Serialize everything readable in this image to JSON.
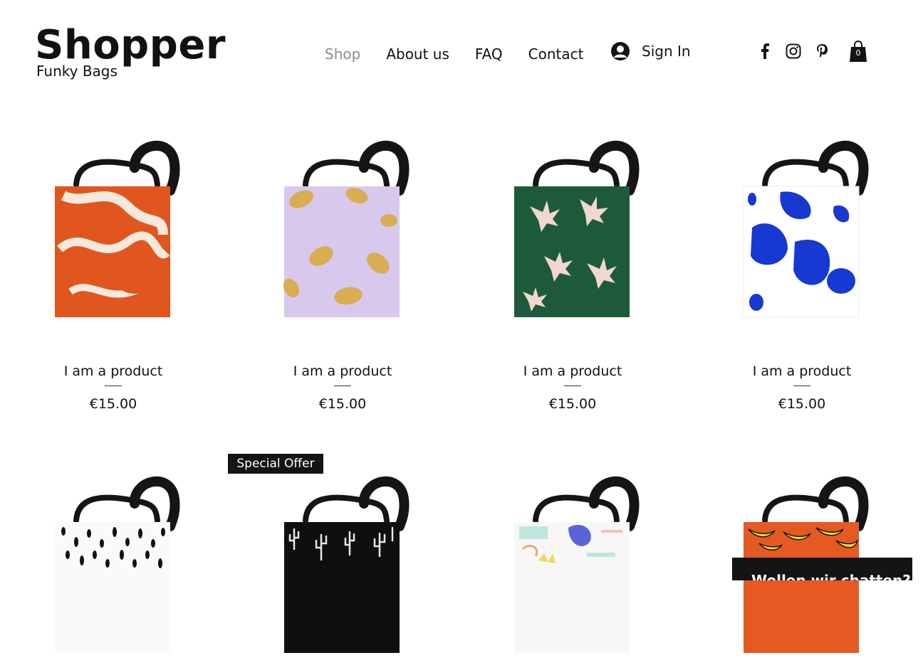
{
  "brand": {
    "title": "Shopper",
    "subtitle": "Funky Bags"
  },
  "nav": {
    "items": [
      {
        "label": "Shop",
        "active": true
      },
      {
        "label": "About us"
      },
      {
        "label": "FAQ"
      },
      {
        "label": "Contact"
      }
    ]
  },
  "account": {
    "signin_label": "Sign In",
    "icon": "user-avatar-icon"
  },
  "social": [
    "facebook-icon",
    "instagram-icon",
    "pinterest-icon"
  ],
  "cart": {
    "count": "0",
    "icon": "shopping-bag-icon"
  },
  "products": [
    {
      "name": "I am a product",
      "price": "€15.00",
      "pattern": "orange-abstract",
      "colors": [
        "#e0561e",
        "#f4e9dc"
      ]
    },
    {
      "name": "I am a product",
      "price": "€15.00",
      "pattern": "lemons",
      "colors": [
        "#d8c8ee",
        "#d9ad52"
      ]
    },
    {
      "name": "I am a product",
      "price": "€15.00",
      "pattern": "green-hands",
      "colors": [
        "#1d5a3b",
        "#f1d7cf"
      ]
    },
    {
      "name": "I am a product",
      "price": "€15.00",
      "pattern": "blue-blobs",
      "colors": [
        "#ffffff",
        "#1739d1"
      ]
    },
    {
      "name": "",
      "price": "",
      "pattern": "black-dots",
      "colors": [
        "#fafafa",
        "#111111"
      ]
    },
    {
      "name": "",
      "price": "",
      "pattern": "cactus",
      "colors": [
        "#0f0f0f",
        "#e8e8e8"
      ],
      "ribbon": "Special Offer"
    },
    {
      "name": "",
      "price": "",
      "pattern": "pastel-brush",
      "colors": [
        "#f7f7f7",
        "#5b63d8"
      ]
    },
    {
      "name": "",
      "price": "",
      "pattern": "bananas",
      "colors": [
        "#e45a22",
        "#f2d33b"
      ]
    }
  ],
  "ribbon": {
    "label": "Special Offer"
  },
  "chat": {
    "label": "Wollen wir chatten?"
  }
}
